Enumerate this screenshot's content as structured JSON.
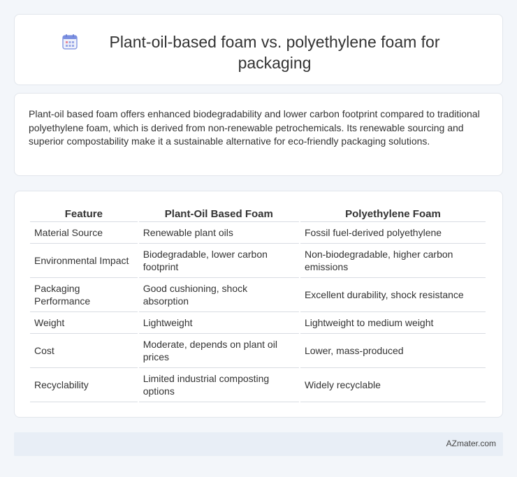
{
  "header": {
    "title": "Plant-oil-based foam vs. polyethylene foam for packaging",
    "icon": "calendar-icon",
    "icon_color": "#7b8fe0"
  },
  "description": {
    "text": "Plant-oil based foam offers enhanced biodegradability and lower carbon footprint compared to traditional polyethylene foam, which is derived from non-renewable petrochemicals. Its renewable sourcing and superior compostability make it a sustainable alternative for eco-friendly packaging solutions."
  },
  "table": {
    "headers": [
      "Feature",
      "Plant-Oil Based Foam",
      "Polyethylene Foam"
    ],
    "rows": [
      [
        "Material Source",
        "Renewable plant oils",
        "Fossil fuel-derived polyethylene"
      ],
      [
        "Environmental Impact",
        "Biodegradable, lower carbon footprint",
        "Non-biodegradable, higher carbon emissions"
      ],
      [
        "Packaging Performance",
        "Good cushioning, shock absorption",
        "Excellent durability, shock resistance"
      ],
      [
        "Weight",
        "Lightweight",
        "Lightweight to medium weight"
      ],
      [
        "Cost",
        "Moderate, depends on plant oil prices",
        "Lower, mass-produced"
      ],
      [
        "Recyclability",
        "Limited industrial composting options",
        "Widely recyclable"
      ]
    ]
  },
  "footer": {
    "brand": "AZmater.com"
  }
}
